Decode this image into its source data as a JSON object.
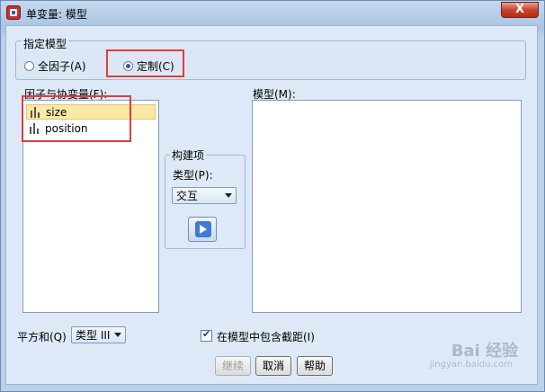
{
  "window": {
    "title": "单变量: 模型",
    "close_glyph": "X"
  },
  "specify_model": {
    "group_label": "指定模型",
    "full_factorial_label": "全因子(A)",
    "custom_label": "定制(C)",
    "selected": "custom"
  },
  "factors": {
    "label": "因子与协变量(F):",
    "items": [
      "size",
      "position"
    ],
    "selected_index": 0
  },
  "model": {
    "label": "模型(M):"
  },
  "build_terms": {
    "group_label": "构建项",
    "type_label": "类型(P):",
    "type_value": "交互"
  },
  "bottom": {
    "sum_of_squares_label": "平方和(Q)",
    "sum_of_squares_value": "类型 III",
    "include_intercept_label": "在模型中包含截距(I)",
    "include_intercept_checked": true
  },
  "buttons": {
    "continue": "继续",
    "cancel": "取消",
    "help": "帮助"
  },
  "watermark": {
    "brand": "Bai 经验",
    "sub": "jingyan.baidu.com"
  }
}
